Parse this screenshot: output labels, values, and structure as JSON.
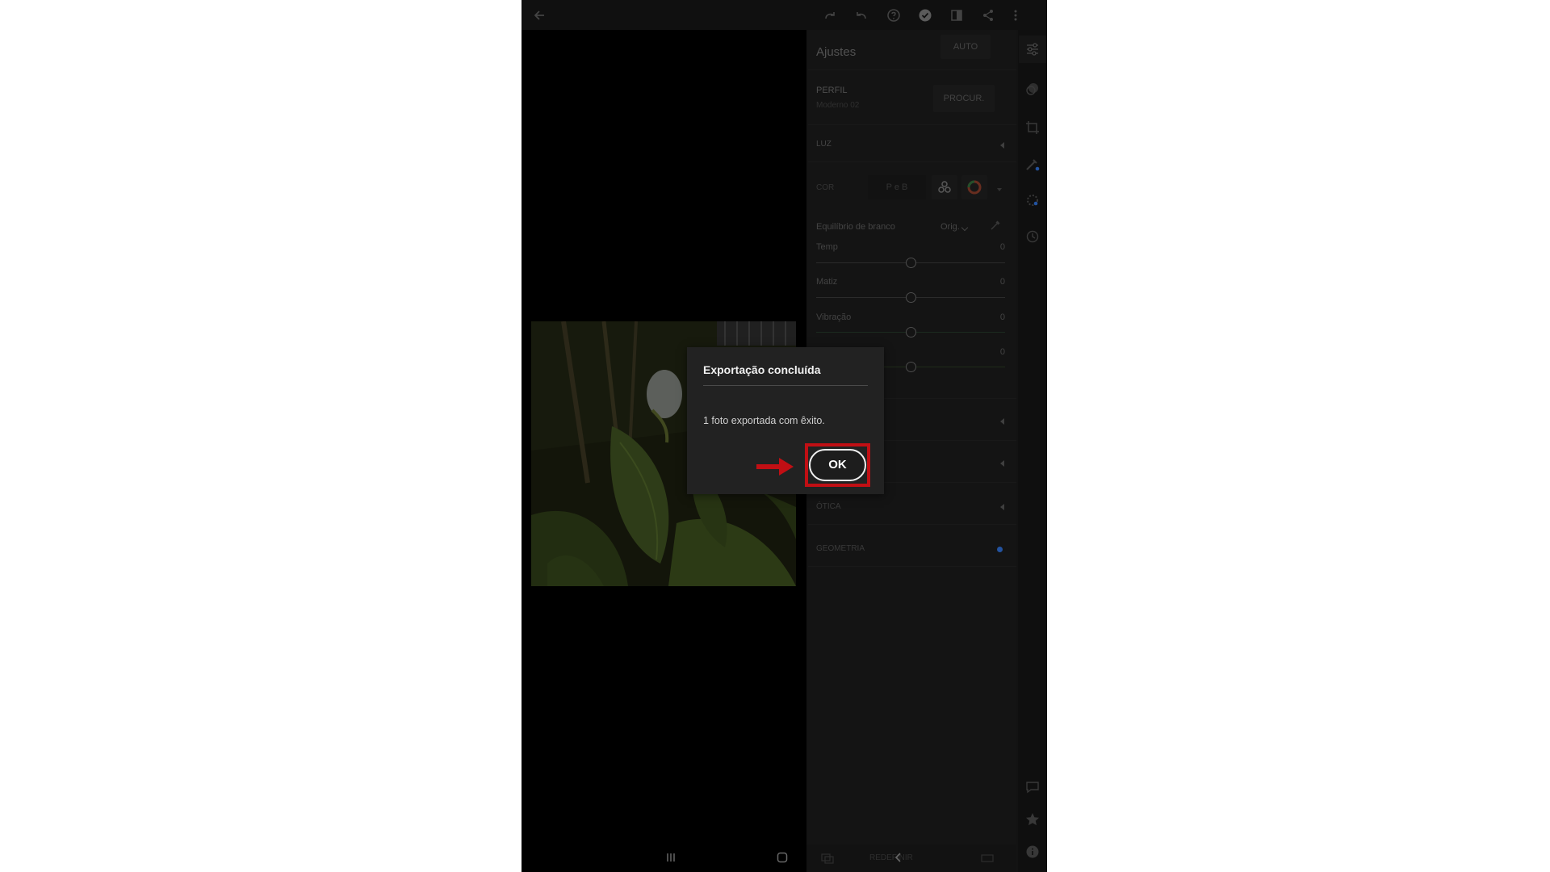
{
  "colors": {
    "highlight": "#c10f14",
    "dialog_bg": "#222222",
    "panel_bg": "#1a1a1a",
    "accent_blue": "#2f6fd6"
  },
  "topbar": {
    "icons": [
      "back-arrow-icon",
      "redo-icon",
      "undo-icon",
      "help-icon",
      "check-icon",
      "compare-icon",
      "share-icon",
      "more-icon"
    ]
  },
  "panel": {
    "title": "Ajustes",
    "auto_label": "AUTO",
    "profile_label": "PERFIL",
    "profile_value": "Moderno 02",
    "browse_label": "PROCUR.",
    "luz_label": "LUZ",
    "cor_label": "COR",
    "peb_label": "P e B",
    "wb_label": "Equilíbrio de branco",
    "wb_value": "Orig.",
    "sliders": [
      {
        "label": "Temp",
        "value": "0",
        "fraction": 0.5
      },
      {
        "label": "Matiz",
        "value": "0",
        "fraction": 0.5
      },
      {
        "label": "Vibração",
        "value": "0",
        "fraction": 0.5
      },
      {
        "label": "",
        "value": "0",
        "fraction": 0.5
      }
    ],
    "otica_label": "ÓTICA",
    "geometria_label": "GEOMETRIA",
    "reset_label": "REDEFINIR"
  },
  "rail": {
    "icons": [
      "sliders-icon",
      "presets-icon",
      "crop-icon",
      "healing-brush-icon",
      "selective-icon",
      "history-icon",
      "comment-icon",
      "star-icon",
      "info-icon"
    ]
  },
  "dialog": {
    "title": "Exportação concluída",
    "message": "1 foto exportada com êxito.",
    "ok_label": "OK"
  }
}
